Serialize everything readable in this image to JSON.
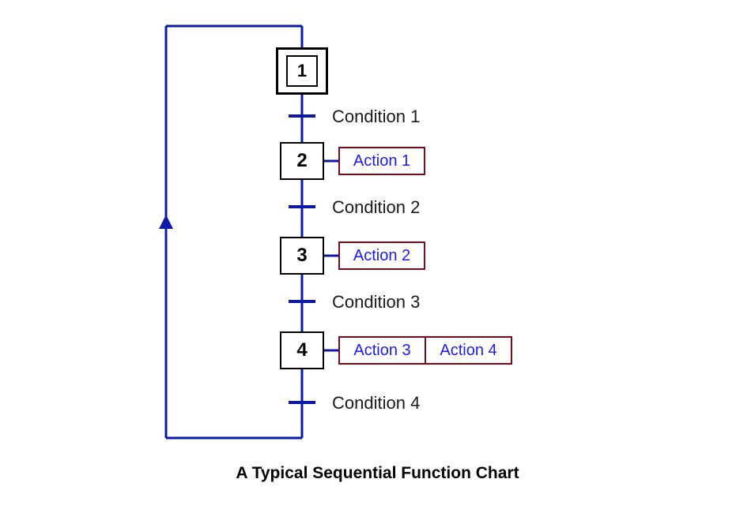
{
  "caption": "A Typical Sequential Function Chart",
  "steps": {
    "s1": "1",
    "s2": "2",
    "s3": "3",
    "s4": "4"
  },
  "actions": {
    "a1": "Action 1",
    "a2": "Action 2",
    "a3": "Action 3",
    "a4": "Action 4"
  },
  "conditions": {
    "c1": "Condition 1",
    "c2": "Condition 2",
    "c3": "Condition 3",
    "c4": "Condition 4"
  },
  "colors": {
    "flow_line": "#0b1aa8",
    "transition_bar": "#0b1aa8",
    "step_border": "#000000",
    "action_border": "#7a0d16",
    "action_text": "#1a1aff"
  }
}
